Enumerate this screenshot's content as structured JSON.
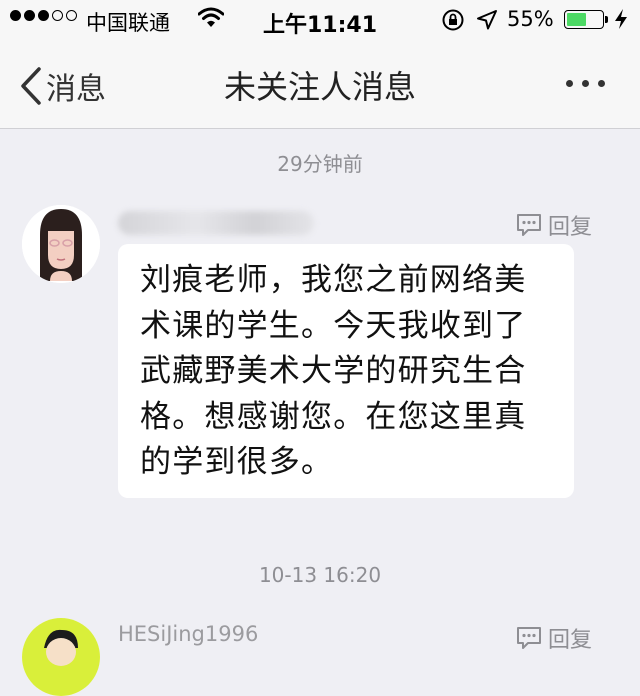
{
  "status_bar": {
    "carrier": "中国联通",
    "time": "上午11:41",
    "battery_percent": "55%",
    "battery_level": 0.55,
    "signal_dots": [
      true,
      true,
      true,
      false,
      false
    ],
    "icons": [
      "wifi-icon",
      "rotation-lock-icon",
      "location-arrow-icon",
      "battery-icon",
      "charging-bolt-icon"
    ]
  },
  "nav": {
    "back_label": "消息",
    "title": "未关注人消息"
  },
  "messages": [
    {
      "timestamp": "29分钟前",
      "sender": "",
      "reply_label": "回复",
      "text": "刘痕老师，我您之前网络美术课的学生。今天我收到了武藏野美术大学的研究生合格。想感谢您。在您这里真的学到很多。"
    },
    {
      "timestamp": "10-13 16:20",
      "sender": "HESiJing1996",
      "reply_label": "回复"
    }
  ],
  "colors": {
    "background": "#efeff4",
    "bar": "#f7f7f7",
    "battery": "#4cd964",
    "muted_text": "#8e8e93"
  }
}
